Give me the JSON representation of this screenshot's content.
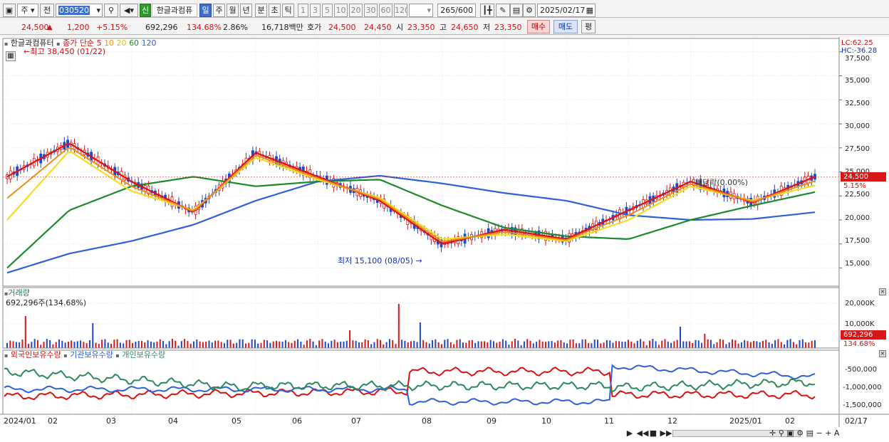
{
  "toolbar": {
    "market": "주",
    "prev": "전",
    "code": "030520",
    "new_badge": "신",
    "stock_name": "한글과컴퓨",
    "periods": [
      "일",
      "주",
      "월",
      "년",
      "분",
      "초",
      "틱"
    ],
    "active_period": "일",
    "intervals": [
      "1",
      "3",
      "5",
      "10",
      "20",
      "30",
      "60",
      "120"
    ],
    "count": "265",
    "count_total": "/600",
    "date": "2025/02/17"
  },
  "quote": {
    "price": "24,500",
    "change": "1,200",
    "change_pct": "+5.15%",
    "volume": "692,296",
    "volume_ratio": "134.68%",
    "turnover": "2.86%",
    "amount": "16,718백만",
    "ask_label": "호가",
    "ask": "24,500",
    "bid": "24,450",
    "open_label": "시",
    "open": "23,350",
    "high_label": "고",
    "high": "24,650",
    "low_label": "저",
    "low": "23,350",
    "buy_label": "매수",
    "sell_label": "매도",
    "eval_label": "평"
  },
  "main_chart": {
    "name": "한글과컴퓨터",
    "legend_title": "종가 단순",
    "ma_periods": [
      "5",
      "10",
      "20",
      "60",
      "120"
    ],
    "ma_colors": [
      "#e01010",
      "#f08c1c",
      "#f0e020",
      "#1a8a2a",
      "#2f60d8"
    ],
    "high_note": "←최고 38,450 (01/22)",
    "low_note": "최저 15,100 (08/05)",
    "dividend_note": "배당락(0.00%)",
    "lc": "LC:62.25",
    "hc": "HC:-36.28",
    "price_ticks": [
      "37,500",
      "35,000",
      "32,500",
      "30,000",
      "27,500",
      "25,000",
      "22,500",
      "20,000",
      "17,500",
      "15,000"
    ],
    "last_price_tag": "24,500",
    "last_pct_tag": "5.15%"
  },
  "volume_panel": {
    "title": "거래량",
    "value": "692,296주(134.68%)",
    "ticks": [
      "20,000K",
      "10,000K"
    ],
    "value_tag": "692,296",
    "pct_tag": "134.68%"
  },
  "holding_panel": {
    "legends": [
      "외국인보유수량",
      "기관보유수량",
      "개인보유수량"
    ],
    "colors": [
      "#e01010",
      "#2f60d8",
      "#2a8a5a"
    ],
    "ticks": [
      "-500,000",
      "-1,000,000",
      "-1,500,000"
    ]
  },
  "x_axis": {
    "labels": [
      "2024/01",
      "02",
      "03",
      "04",
      "05",
      "06",
      "07",
      "08",
      "09",
      "10",
      "11",
      "12",
      "2025/01",
      "02"
    ],
    "end_label": "02/17"
  },
  "chart_data": {
    "type": "line",
    "title": "한글과컴퓨터",
    "y_range": [
      14000,
      38000
    ],
    "x": [
      "2024-01",
      "2024-02",
      "2024-03",
      "2024-04",
      "2024-05",
      "2024-06",
      "2024-07",
      "2024-08",
      "2024-09",
      "2024-10",
      "2024-11",
      "2024-12",
      "2025-01",
      "2025-02"
    ],
    "series": [
      {
        "name": "5",
        "values": [
          24500,
          28000,
          24000,
          20800,
          27000,
          24500,
          22000,
          17500,
          19000,
          18000,
          21000,
          24000,
          21800,
          24500
        ]
      },
      {
        "name": "20",
        "values": [
          20000,
          27200,
          23000,
          21000,
          26500,
          24200,
          22300,
          18000,
          18500,
          17800,
          20000,
          23500,
          22000,
          23600
        ]
      },
      {
        "name": "60",
        "values": [
          15000,
          21000,
          23500,
          24500,
          23500,
          24000,
          24200,
          21500,
          19200,
          18300,
          18000,
          20000,
          21500,
          22900
        ]
      },
      {
        "name": "120",
        "values": [
          14500,
          16500,
          17800,
          19500,
          22000,
          24000,
          24600,
          23800,
          22800,
          22000,
          20500,
          20000,
          20100,
          20800
        ]
      }
    ]
  }
}
